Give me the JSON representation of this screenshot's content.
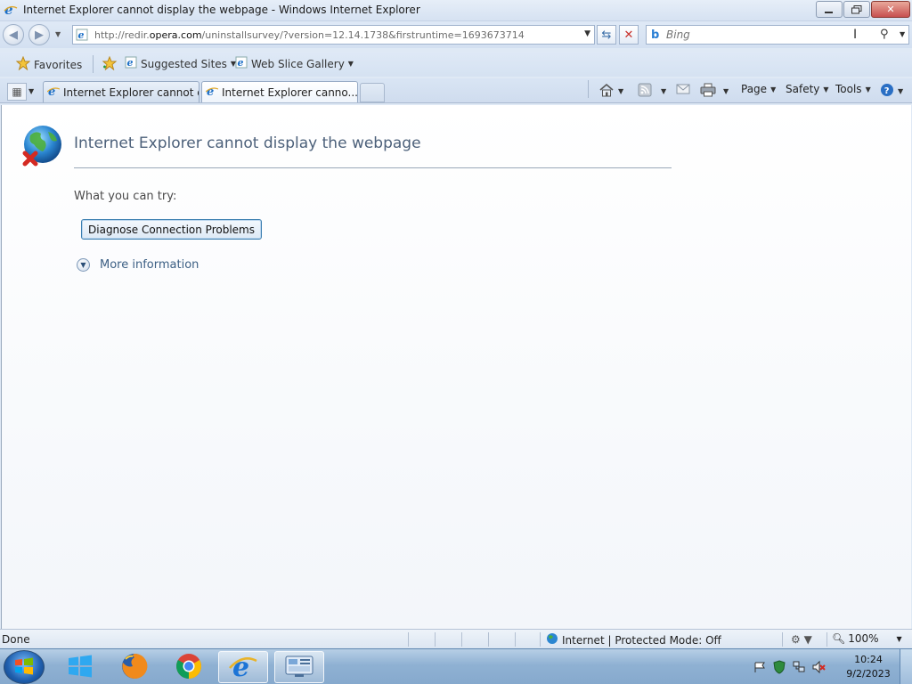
{
  "window": {
    "title": "Internet Explorer cannot display the webpage - Windows Internet Explorer",
    "buttons": {
      "minimize": "",
      "restore": "",
      "close": "✕"
    }
  },
  "address": {
    "url_prefix": "http://redir.",
    "url_domain": "opera.com",
    "url_rest": "/uninstallsurvey/?version=12.14.1738&firstruntime=1693673714"
  },
  "search": {
    "placeholder": "Bing"
  },
  "favorites": {
    "favorites_label": "Favorites",
    "suggested_sites": "Suggested Sites",
    "web_slice_gallery": "Web Slice Gallery"
  },
  "tabs": [
    {
      "label": "Internet Explorer cannot di...",
      "active": false
    },
    {
      "label": "Internet Explorer canno...",
      "active": true
    }
  ],
  "command_bar": {
    "page": "Page",
    "safety": "Safety",
    "tools": "Tools"
  },
  "content": {
    "heading": "Internet Explorer cannot display the webpage",
    "try_label": "What you can try:",
    "diagnose_button": "Diagnose Connection Problems",
    "more_information": "More information"
  },
  "status": {
    "left": "Done",
    "zone": "Internet | Protected Mode: Off",
    "zoom": "100%"
  },
  "taskbar": {
    "time": "10:24",
    "date": "9/2/2023",
    "pinned": [
      "windows-store-icon",
      "firefox-icon",
      "chrome-icon",
      "internet-explorer-icon",
      "control-panel-icon"
    ]
  },
  "colors": {
    "heading": "#4c607a",
    "link": "#3c5f84",
    "button_border": "#3c7fb1"
  }
}
